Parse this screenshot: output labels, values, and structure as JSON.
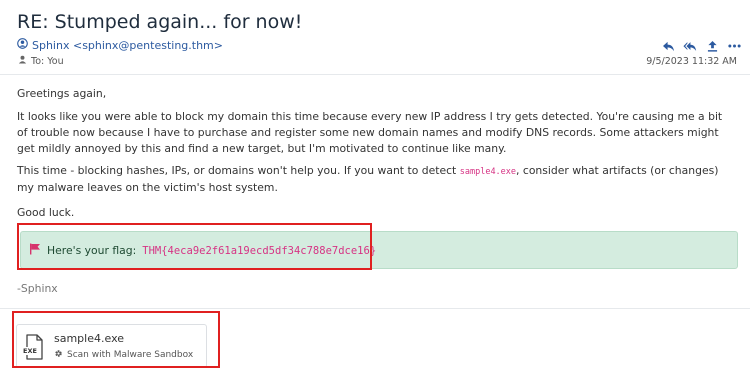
{
  "email": {
    "subject": "RE: Stumped again... for now!",
    "from": "Sphinx <sphinx@pentesting.thm>",
    "to": "To: You",
    "date": "9/5/2023 11:32 AM",
    "actions": [
      "reply-icon",
      "reply-all-icon",
      "forward-icon",
      "more-icon"
    ],
    "greeting": "Greetings again,",
    "p1": "It looks like you were able to block my domain this time because every new IP address I try gets detected. You're causing me a bit of trouble now because I have to purchase and register some new domain names and modify DNS records. Some attackers might get mildly annoyed by this and find a new target, but I'm motivated to continue like many.",
    "p2_before": "This time - blocking hashes, IPs, or domains won't help you. If you want to detect ",
    "p2_code": "sample4.exe",
    "p2_after": ", consider what artifacts (or changes) my malware leaves on the victim's host system.",
    "closing": "Good luck.",
    "flag_label": "Here's your flag:",
    "flag_value": "THM{4eca9e2f61a19ecd5df34c788e7dce16}",
    "signature": "-Sphinx"
  },
  "attachment": {
    "filename": "sample4.exe",
    "file_type": "EXE",
    "scan_label": "Scan with Malware Sandbox"
  },
  "colors": {
    "link": "#2c5aa0",
    "flag_bg": "#d4ecdf",
    "flag_icon": "#d6336c",
    "code": "#d63384",
    "highlight": "#e02020"
  }
}
